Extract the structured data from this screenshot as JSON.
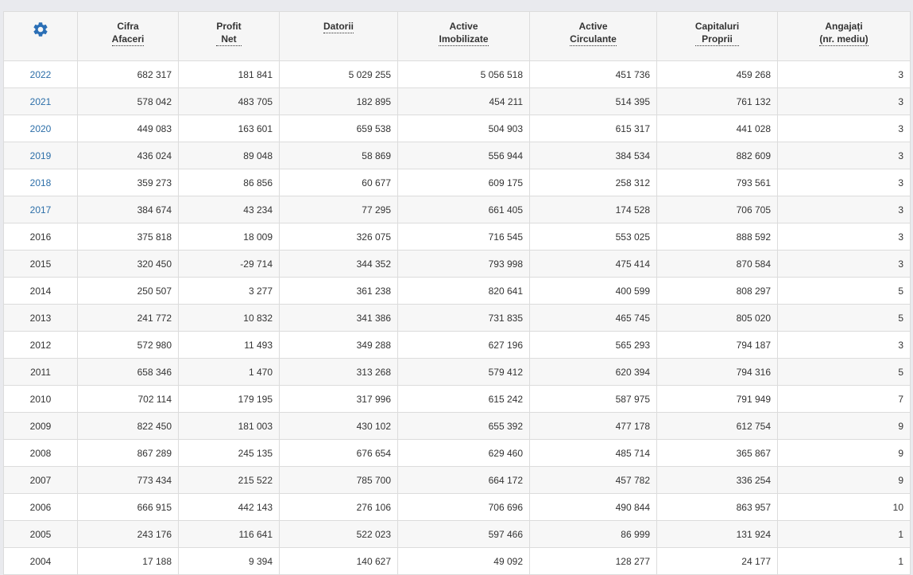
{
  "colors": {
    "link": "#2c6ea8",
    "gear": "#2b6fb6",
    "header_bg": "#f6f6f6",
    "row_alt": "#f7f7f7"
  },
  "settings_icon": "gear-icon",
  "columns": [
    {
      "line1": "Cifra",
      "line2": "Afaceri"
    },
    {
      "line1": "Profit",
      "line2": "Net"
    },
    {
      "line1": "Datorii",
      "line2": ""
    },
    {
      "line1": "Active",
      "line2": "Imobilizate"
    },
    {
      "line1": "Active",
      "line2": "Circulante"
    },
    {
      "line1": "Capitaluri",
      "line2": "Proprii"
    },
    {
      "line1": "Angajați",
      "line2": "(nr. mediu)"
    }
  ],
  "rows": [
    {
      "year": "2022",
      "link": true,
      "values": [
        "682 317",
        "181 841",
        "5 029 255",
        "5 056 518",
        "451 736",
        "459 268",
        "3"
      ]
    },
    {
      "year": "2021",
      "link": true,
      "values": [
        "578 042",
        "483 705",
        "182 895",
        "454 211",
        "514 395",
        "761 132",
        "3"
      ]
    },
    {
      "year": "2020",
      "link": true,
      "values": [
        "449 083",
        "163 601",
        "659 538",
        "504 903",
        "615 317",
        "441 028",
        "3"
      ]
    },
    {
      "year": "2019",
      "link": true,
      "values": [
        "436 024",
        "89 048",
        "58 869",
        "556 944",
        "384 534",
        "882 609",
        "3"
      ]
    },
    {
      "year": "2018",
      "link": true,
      "values": [
        "359 273",
        "86 856",
        "60 677",
        "609 175",
        "258 312",
        "793 561",
        "3"
      ]
    },
    {
      "year": "2017",
      "link": true,
      "values": [
        "384 674",
        "43 234",
        "77 295",
        "661 405",
        "174 528",
        "706 705",
        "3"
      ]
    },
    {
      "year": "2016",
      "link": false,
      "values": [
        "375 818",
        "18 009",
        "326 075",
        "716 545",
        "553 025",
        "888 592",
        "3"
      ]
    },
    {
      "year": "2015",
      "link": false,
      "values": [
        "320 450",
        "-29 714",
        "344 352",
        "793 998",
        "475 414",
        "870 584",
        "3"
      ]
    },
    {
      "year": "2014",
      "link": false,
      "values": [
        "250 507",
        "3 277",
        "361 238",
        "820 641",
        "400 599",
        "808 297",
        "5"
      ]
    },
    {
      "year": "2013",
      "link": false,
      "values": [
        "241 772",
        "10 832",
        "341 386",
        "731 835",
        "465 745",
        "805 020",
        "5"
      ]
    },
    {
      "year": "2012",
      "link": false,
      "values": [
        "572 980",
        "11 493",
        "349 288",
        "627 196",
        "565 293",
        "794 187",
        "3"
      ]
    },
    {
      "year": "2011",
      "link": false,
      "values": [
        "658 346",
        "1 470",
        "313 268",
        "579 412",
        "620 394",
        "794 316",
        "5"
      ]
    },
    {
      "year": "2010",
      "link": false,
      "values": [
        "702 114",
        "179 195",
        "317 996",
        "615 242",
        "587 975",
        "791 949",
        "7"
      ]
    },
    {
      "year": "2009",
      "link": false,
      "values": [
        "822 450",
        "181 003",
        "430 102",
        "655 392",
        "477 178",
        "612 754",
        "9"
      ]
    },
    {
      "year": "2008",
      "link": false,
      "values": [
        "867 289",
        "245 135",
        "676 654",
        "629 460",
        "485 714",
        "365 867",
        "9"
      ]
    },
    {
      "year": "2007",
      "link": false,
      "values": [
        "773 434",
        "215 522",
        "785 700",
        "664 172",
        "457 782",
        "336 254",
        "9"
      ]
    },
    {
      "year": "2006",
      "link": false,
      "values": [
        "666 915",
        "442 143",
        "276 106",
        "706 696",
        "490 844",
        "863 957",
        "10"
      ]
    },
    {
      "year": "2005",
      "link": false,
      "values": [
        "243 176",
        "116 641",
        "522 023",
        "597 466",
        "86 999",
        "131 924",
        "1"
      ]
    },
    {
      "year": "2004",
      "link": false,
      "values": [
        "17 188",
        "9 394",
        "140 627",
        "49 092",
        "128 277",
        "24 177",
        "1"
      ]
    }
  ]
}
